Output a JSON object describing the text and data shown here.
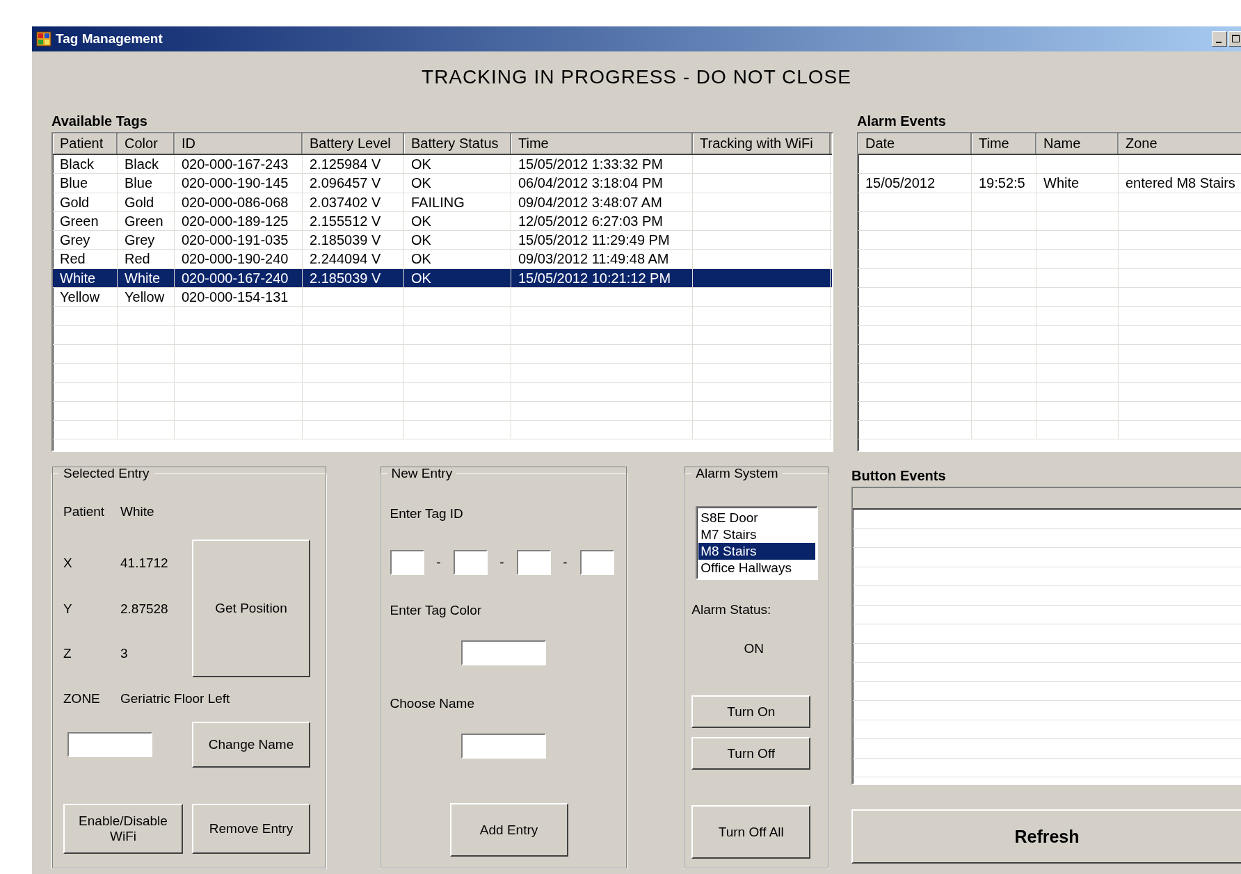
{
  "window": {
    "title": "Tag Management"
  },
  "banner": "TRACKING IN PROGRESS - DO NOT CLOSE",
  "available_tags": {
    "title": "Available Tags",
    "columns": [
      "Patient",
      "Color",
      "ID",
      "Battery Level",
      "Battery Status",
      "Time",
      "Tracking with WiFi"
    ],
    "rows": [
      {
        "patient": "Black",
        "color_name": "Black",
        "id": "020-000-167-243",
        "battery_level": "2.125984 V",
        "battery_status": "OK",
        "time": "15/05/2012 1:33:32 PM",
        "selected": false
      },
      {
        "patient": "Blue",
        "color_name": "Blue",
        "id": "020-000-190-145",
        "battery_level": "2.096457 V",
        "battery_status": "OK",
        "time": "06/04/2012 3:18:04 PM",
        "selected": false
      },
      {
        "patient": "Gold",
        "color_name": "Gold",
        "id": "020-000-086-068",
        "battery_level": "2.037402 V",
        "battery_status": "FAILING",
        "time": "09/04/2012 3:48:07 AM",
        "selected": false
      },
      {
        "patient": "Green",
        "color_name": "Green",
        "id": "020-000-189-125",
        "battery_level": "2.155512 V",
        "battery_status": "OK",
        "time": "12/05/2012 6:27:03 PM",
        "selected": false
      },
      {
        "patient": "Grey",
        "color_name": "Grey",
        "id": "020-000-191-035",
        "battery_level": "2.185039 V",
        "battery_status": "OK",
        "time": "15/05/2012 11:29:49 PM",
        "selected": false
      },
      {
        "patient": "Red",
        "color_name": "Red",
        "id": "020-000-190-240",
        "battery_level": "2.244094 V",
        "battery_status": "OK",
        "time": "09/03/2012 11:49:48 AM",
        "selected": false
      },
      {
        "patient": "White",
        "color_name": "White",
        "id": "020-000-167-240",
        "battery_level": "2.185039 V",
        "battery_status": "OK",
        "time": "15/05/2012 10:21:12 PM",
        "selected": true
      },
      {
        "patient": "Yellow",
        "color_name": "Yellow",
        "id": "020-000-154-131",
        "selected": false
      }
    ]
  },
  "alarm_events": {
    "title": "Alarm Events",
    "columns": [
      "Date",
      "Time",
      "Name",
      "Zone"
    ],
    "rows": [
      {
        "date": "15/05/2012",
        "time": "19:52:5",
        "name": "White",
        "zone": "entered M8 Stairs"
      }
    ]
  },
  "selected_entry": {
    "title": "Selected Entry",
    "patient_label": "Patient",
    "patient_value": "White",
    "x_label": "X",
    "x_value": "41.1712",
    "y_label": "Y",
    "y_value": "2.87528",
    "z_label": "Z",
    "z_value": "3",
    "zone_label": "ZONE",
    "zone_value": "Geriatric Floor Left",
    "get_position": "Get Position",
    "change_name": "Change Name",
    "enable_wifi": "Enable/Disable WiFi",
    "remove_entry": "Remove Entry"
  },
  "new_entry": {
    "title": "New Entry",
    "tag_id_label": "Enter Tag ID",
    "separators": [
      "-",
      "-",
      "-"
    ],
    "tag_color_label": "Enter Tag Color",
    "choose_name_label": "Choose Name",
    "add_entry": "Add Entry"
  },
  "alarm_system": {
    "title": "Alarm System",
    "zones": [
      {
        "label": "S8E Door",
        "selected": false
      },
      {
        "label": "M7 Stairs",
        "selected": false
      },
      {
        "label": "M8 Stairs",
        "selected": true
      },
      {
        "label": "Office Hallways",
        "selected": false
      }
    ],
    "status_label": "Alarm Status:",
    "status_value": "ON",
    "turn_on": "Turn On",
    "turn_off": "Turn Off",
    "turn_off_all": "Turn Off All"
  },
  "button_events": {
    "title": "Button Events"
  },
  "refresh": "Refresh"
}
